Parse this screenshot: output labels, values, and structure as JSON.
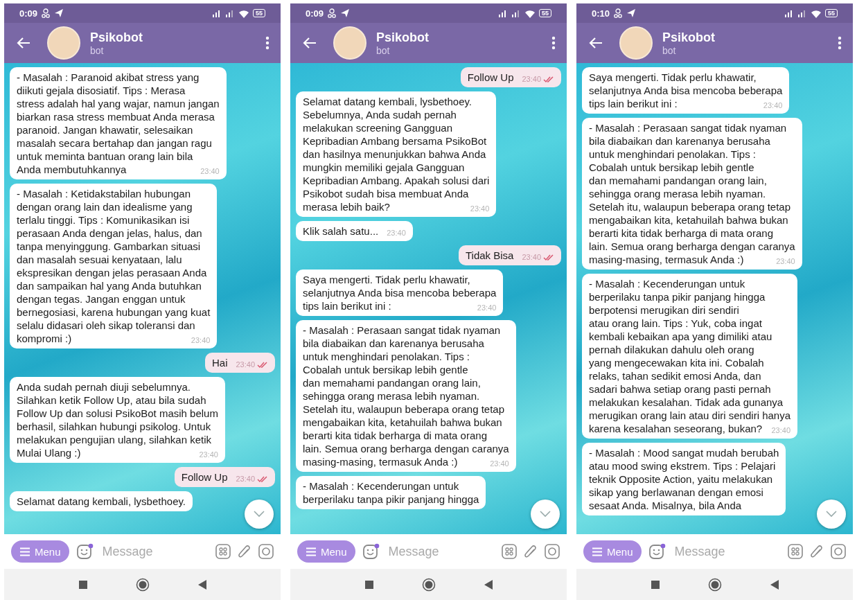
{
  "phones": [
    {
      "status_bar": {
        "time": "0:09",
        "battery": "55"
      },
      "header": {
        "title": "Psikobot",
        "subtitle": "bot"
      },
      "messages": [
        {
          "kind": "incoming",
          "text": "- Masalah : Paranoid akibat stress yang\ndiikuti gejala disosiatif. Tips : Merasa\nstress adalah hal yang wajar, namun jangan\nbiarkan rasa stress membuat Anda merasa\nparanoid. Jangan khawatir, selesaikan\nmasalah secara bertahap dan jangan ragu\nuntuk meminta bantuan orang lain bila\nAnda membutuhkannya",
          "time": "23:40"
        },
        {
          "kind": "incoming",
          "text": "- Masalah : Ketidakstabilan hubungan\ndengan orang lain dan idealisme yang\nterlalu tinggi. Tips : Komunikasikan isi\nperasaan Anda dengan jelas, halus, dan\ntanpa menyinggung. Gambarkan situasi\ndan masalah sesuai kenyataan, lalu\nekspresikan dengan jelas perasaan Anda\ndan sampaikan hal yang Anda butuhkan\ndengan tegas. Jangan enggan untuk\nbernegosiasi, karena hubungan yang kuat\nselalu didasari oleh sikap toleransi dan\nkompromi :)",
          "time": "23:40"
        },
        {
          "kind": "outgoing",
          "text": "Hai",
          "time": "23:40",
          "read": true
        },
        {
          "kind": "incoming",
          "text": "Anda sudah pernah diuji sebelumnya.\nSilahkan ketik Follow Up, atau bila sudah\nFollow Up dan solusi PsikoBot masih belum\nberhasil, silahkan hubungi psikolog. Untuk\nmelakukan pengujian ulang, silahkan ketik\nMulai Ulang :)",
          "time": "23:40"
        },
        {
          "kind": "outgoing",
          "text": "Follow Up",
          "time": "23:40",
          "read": true
        },
        {
          "kind": "incoming",
          "text": "Selamat datang kembali, lysbethoey."
        }
      ],
      "composer": {
        "menu": "Menu",
        "placeholder": "Message"
      }
    },
    {
      "status_bar": {
        "time": "0:09",
        "battery": "55"
      },
      "header": {
        "title": "Psikobot",
        "subtitle": "bot"
      },
      "messages": [
        {
          "kind": "outgoing",
          "text": "Follow Up",
          "time": "23:40",
          "read": true
        },
        {
          "kind": "incoming",
          "text": "Selamat datang kembali, lysbethoey.\nSebelumnya, Anda sudah pernah\nmelakukan screening Gangguan\nKepribadian Ambang bersama PsikoBot\ndan hasilnya menunjukkan bahwa Anda\nmungkin memiliki gejala Gangguan\nKepribadian Ambang. Apakah solusi dari\nPsikobot sudah bisa membuat Anda\nmerasa lebih baik?",
          "time": "23:40"
        },
        {
          "kind": "incoming",
          "text": "Klik salah satu...",
          "time": "23:40"
        },
        {
          "kind": "outgoing",
          "text": "Tidak Bisa",
          "time": "23:40",
          "read": true
        },
        {
          "kind": "incoming",
          "text": "Saya mengerti. Tidak perlu khawatir,\nselanjutnya Anda bisa mencoba beberapa\ntips lain berikut ini :",
          "time": "23:40"
        },
        {
          "kind": "incoming",
          "text": "- Masalah : Perasaan sangat tidak nyaman\nbila diabaikan dan karenanya berusaha\nuntuk menghindari penolakan. Tips :\nCobalah untuk bersikap lebih gentle\ndan memahami pandangan orang lain,\nsehingga orang merasa lebih nyaman.\nSetelah itu, walaupun beberapa orang tetap\nmengabaikan kita, ketahuilah bahwa bukan\nberarti kita tidak berharga di mata orang\nlain. Semua orang berharga dengan caranya\nmasing-masing, termasuk Anda :)",
          "time": "23:40"
        },
        {
          "kind": "incoming",
          "text": "- Masalah : Kecenderungan untuk\nberperilaku tanpa pikir panjang hingga"
        }
      ],
      "composer": {
        "menu": "Menu",
        "placeholder": "Message"
      }
    },
    {
      "status_bar": {
        "time": "0:10",
        "battery": "55"
      },
      "header": {
        "title": "Psikobot",
        "subtitle": "bot"
      },
      "messages": [
        {
          "kind": "incoming",
          "text": "Saya mengerti. Tidak perlu khawatir,\nselanjutnya Anda bisa mencoba beberapa\ntips lain berikut ini :",
          "time": "23:40"
        },
        {
          "kind": "incoming",
          "text": "- Masalah : Perasaan sangat tidak nyaman\nbila diabaikan dan karenanya berusaha\nuntuk menghindari penolakan. Tips :\nCobalah untuk bersikap lebih gentle\ndan memahami pandangan orang lain,\nsehingga orang merasa lebih nyaman.\nSetelah itu, walaupun beberapa orang tetap\nmengabaikan kita, ketahuilah bahwa bukan\nberarti kita tidak berharga di mata orang\nlain. Semua orang berharga dengan caranya\nmasing-masing, termasuk Anda :)",
          "time": "23:40"
        },
        {
          "kind": "incoming",
          "text": "- Masalah : Kecenderungan untuk\nberperilaku tanpa pikir panjang hingga\nberpotensi merugikan diri sendiri\natau orang lain. Tips : Yuk, coba ingat\nkembali kebaikan apa yang dimiliki atau\npernah dilakukan dahulu oleh orang\nyang mengecewakan kita ini. Cobalah\nrelaks, tahan sedikit emosi Anda, dan\nsadari bahwa setiap orang pasti pernah\nmelakukan kesalahan. Tidak ada gunanya\nmerugikan orang lain atau diri sendiri hanya\nkarena kesalahan seseorang, bukan?",
          "time": "23:40"
        },
        {
          "kind": "incoming",
          "text": "- Masalah : Mood sangat mudah berubah\natau mood swing ekstrem. Tips : Pelajari\nteknik Opposite Action, yaitu melakukan\nsikap yang berlawanan dengan emosi\nsesaat Anda. Misalnya, bila Anda"
        }
      ],
      "composer": {
        "menu": "Menu",
        "placeholder": "Message"
      }
    }
  ]
}
